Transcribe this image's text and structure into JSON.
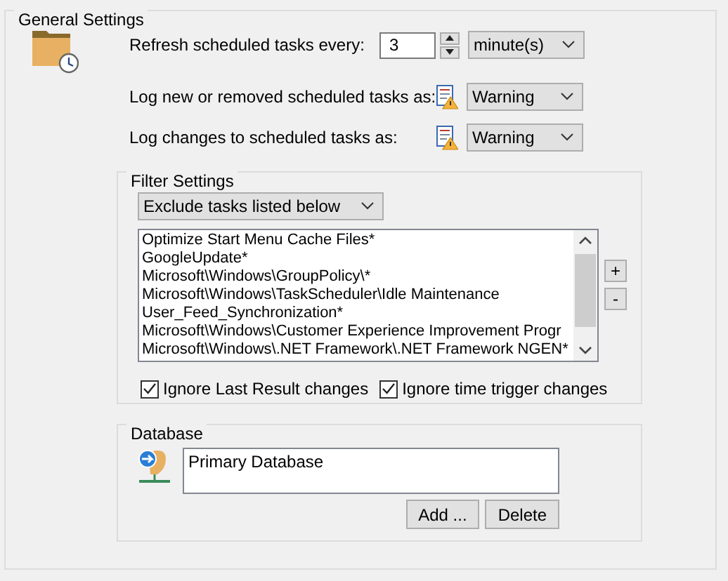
{
  "general_settings": {
    "title": "General Settings",
    "refresh": {
      "label": "Refresh scheduled tasks every:",
      "value": "3",
      "unit": "minute(s)"
    },
    "log_rows": [
      {
        "label": "Log new or removed scheduled tasks as:",
        "value": "Warning"
      },
      {
        "label": "Log changes to scheduled tasks as:",
        "value": "Warning"
      }
    ]
  },
  "filter_settings": {
    "title": "Filter Settings",
    "mode": "Exclude tasks listed below",
    "tasks": [
      "Optimize Start Menu Cache Files*",
      "GoogleUpdate*",
      "Microsoft\\Windows\\GroupPolicy\\*",
      "Microsoft\\Windows\\TaskScheduler\\Idle Maintenance",
      "User_Feed_Synchronization*",
      "Microsoft\\Windows\\Customer Experience Improvement Progr",
      "Microsoft\\Windows\\.NET Framework\\.NET Framework NGEN*"
    ],
    "add_button": "+",
    "remove_button": "-",
    "checkboxes": [
      {
        "label": "Ignore Last Result changes",
        "checked": true
      },
      {
        "label": "Ignore time trigger changes",
        "checked": true
      }
    ]
  },
  "database": {
    "title": "Database",
    "items": [
      "Primary Database"
    ],
    "buttons": [
      "Add ...",
      "Delete"
    ]
  }
}
